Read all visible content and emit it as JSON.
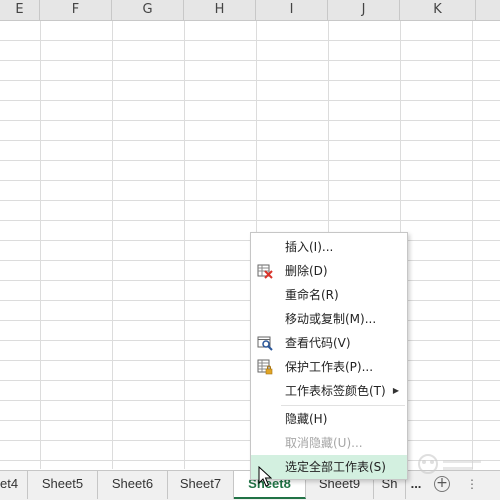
{
  "columns": [
    "E",
    "F",
    "G",
    "H",
    "I",
    "J",
    "K"
  ],
  "sheet_tabs": {
    "tabs": [
      "et4",
      "Sheet5",
      "Sheet6",
      "Sheet7",
      "Sheet8",
      "Sheet9",
      "Sh"
    ],
    "active": "Sheet8",
    "ellipsis": "...",
    "add_icon": "plus-circle-icon",
    "more_icon": "vertical-dots-icon"
  },
  "context_menu": {
    "items": [
      {
        "label": "插入(I)...",
        "icon": "",
        "enabled": true,
        "submenu": false
      },
      {
        "label": "删除(D)",
        "icon": "delete-sheet-icon",
        "enabled": true,
        "submenu": false
      },
      {
        "label": "重命名(R)",
        "icon": "",
        "enabled": true,
        "submenu": false
      },
      {
        "label": "移动或复制(M)...",
        "icon": "",
        "enabled": true,
        "submenu": false
      },
      {
        "label": "查看代码(V)",
        "icon": "view-code-icon",
        "enabled": true,
        "submenu": false
      },
      {
        "label": "保护工作表(P)...",
        "icon": "protect-sheet-icon",
        "enabled": true,
        "submenu": false
      },
      {
        "label": "工作表标签颜色(T)",
        "icon": "",
        "enabled": true,
        "submenu": true
      },
      {
        "label": "隐藏(H)",
        "icon": "",
        "enabled": true,
        "submenu": false
      },
      {
        "label": "取消隐藏(U)...",
        "icon": "",
        "enabled": false,
        "submenu": false
      },
      {
        "label": "选定全部工作表(S)",
        "icon": "",
        "enabled": true,
        "submenu": false,
        "hovered": true
      }
    ]
  },
  "colors": {
    "accent": "#217346",
    "hover": "#d3f0e0",
    "disabled_text": "#a6a6a6"
  }
}
